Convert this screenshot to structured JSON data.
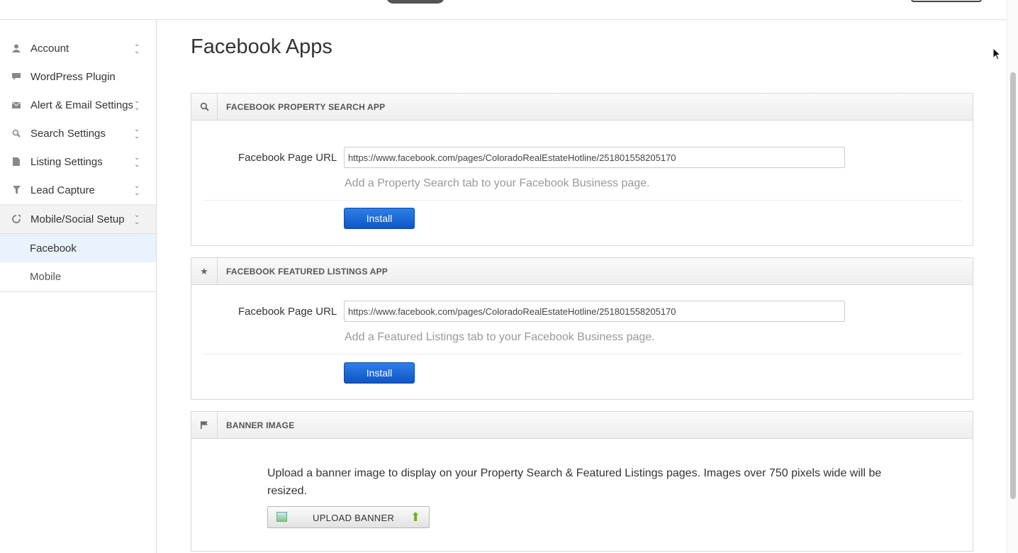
{
  "sidebar": {
    "items": [
      {
        "label": "Account",
        "icon": "user-icon",
        "expandable": true
      },
      {
        "label": "WordPress Plugin",
        "icon": "comment-icon",
        "expandable": false
      },
      {
        "label": "Alert & Email Settings",
        "icon": "envelope-icon",
        "expandable": true
      },
      {
        "label": "Search Settings",
        "icon": "search-icon",
        "expandable": true
      },
      {
        "label": "Listing Settings",
        "icon": "file-icon",
        "expandable": true
      },
      {
        "label": "Lead Capture",
        "icon": "filter-icon",
        "expandable": true
      },
      {
        "label": "Mobile/Social Setup",
        "icon": "share-icon",
        "expandable": true
      }
    ],
    "subitems": [
      {
        "label": "Facebook",
        "selected": true
      },
      {
        "label": "Mobile",
        "selected": false
      }
    ]
  },
  "main": {
    "title": "Facebook Apps",
    "panels": [
      {
        "title": "FACEBOOK PROPERTY SEARCH APP",
        "icon": "search-icon",
        "field_label": "Facebook Page URL",
        "url_value": "https://www.facebook.com/pages/ColoradoRealEstateHotline/251801558205170",
        "help": "Add a Property Search tab to your Facebook Business page.",
        "button": "Install"
      },
      {
        "title": "FACEBOOK FEATURED LISTINGS APP",
        "icon": "star-icon",
        "field_label": "Facebook Page URL",
        "url_value": "https://www.facebook.com/pages/ColoradoRealEstateHotline/251801558205170",
        "help": "Add a Featured Listings tab to your Facebook Business page.",
        "button": "Install"
      },
      {
        "title": "BANNER IMAGE",
        "icon": "flag-icon",
        "text": "Upload a banner image to display on your Property Search & Featured Listings pages. Images over 750 pixels wide will be resized.",
        "button": "UPLOAD BANNER"
      }
    ]
  },
  "colors": {
    "primary_button": "#0f55c7",
    "selected_bg": "#e9f3fd",
    "upload_arrow": "#6cb12a"
  }
}
